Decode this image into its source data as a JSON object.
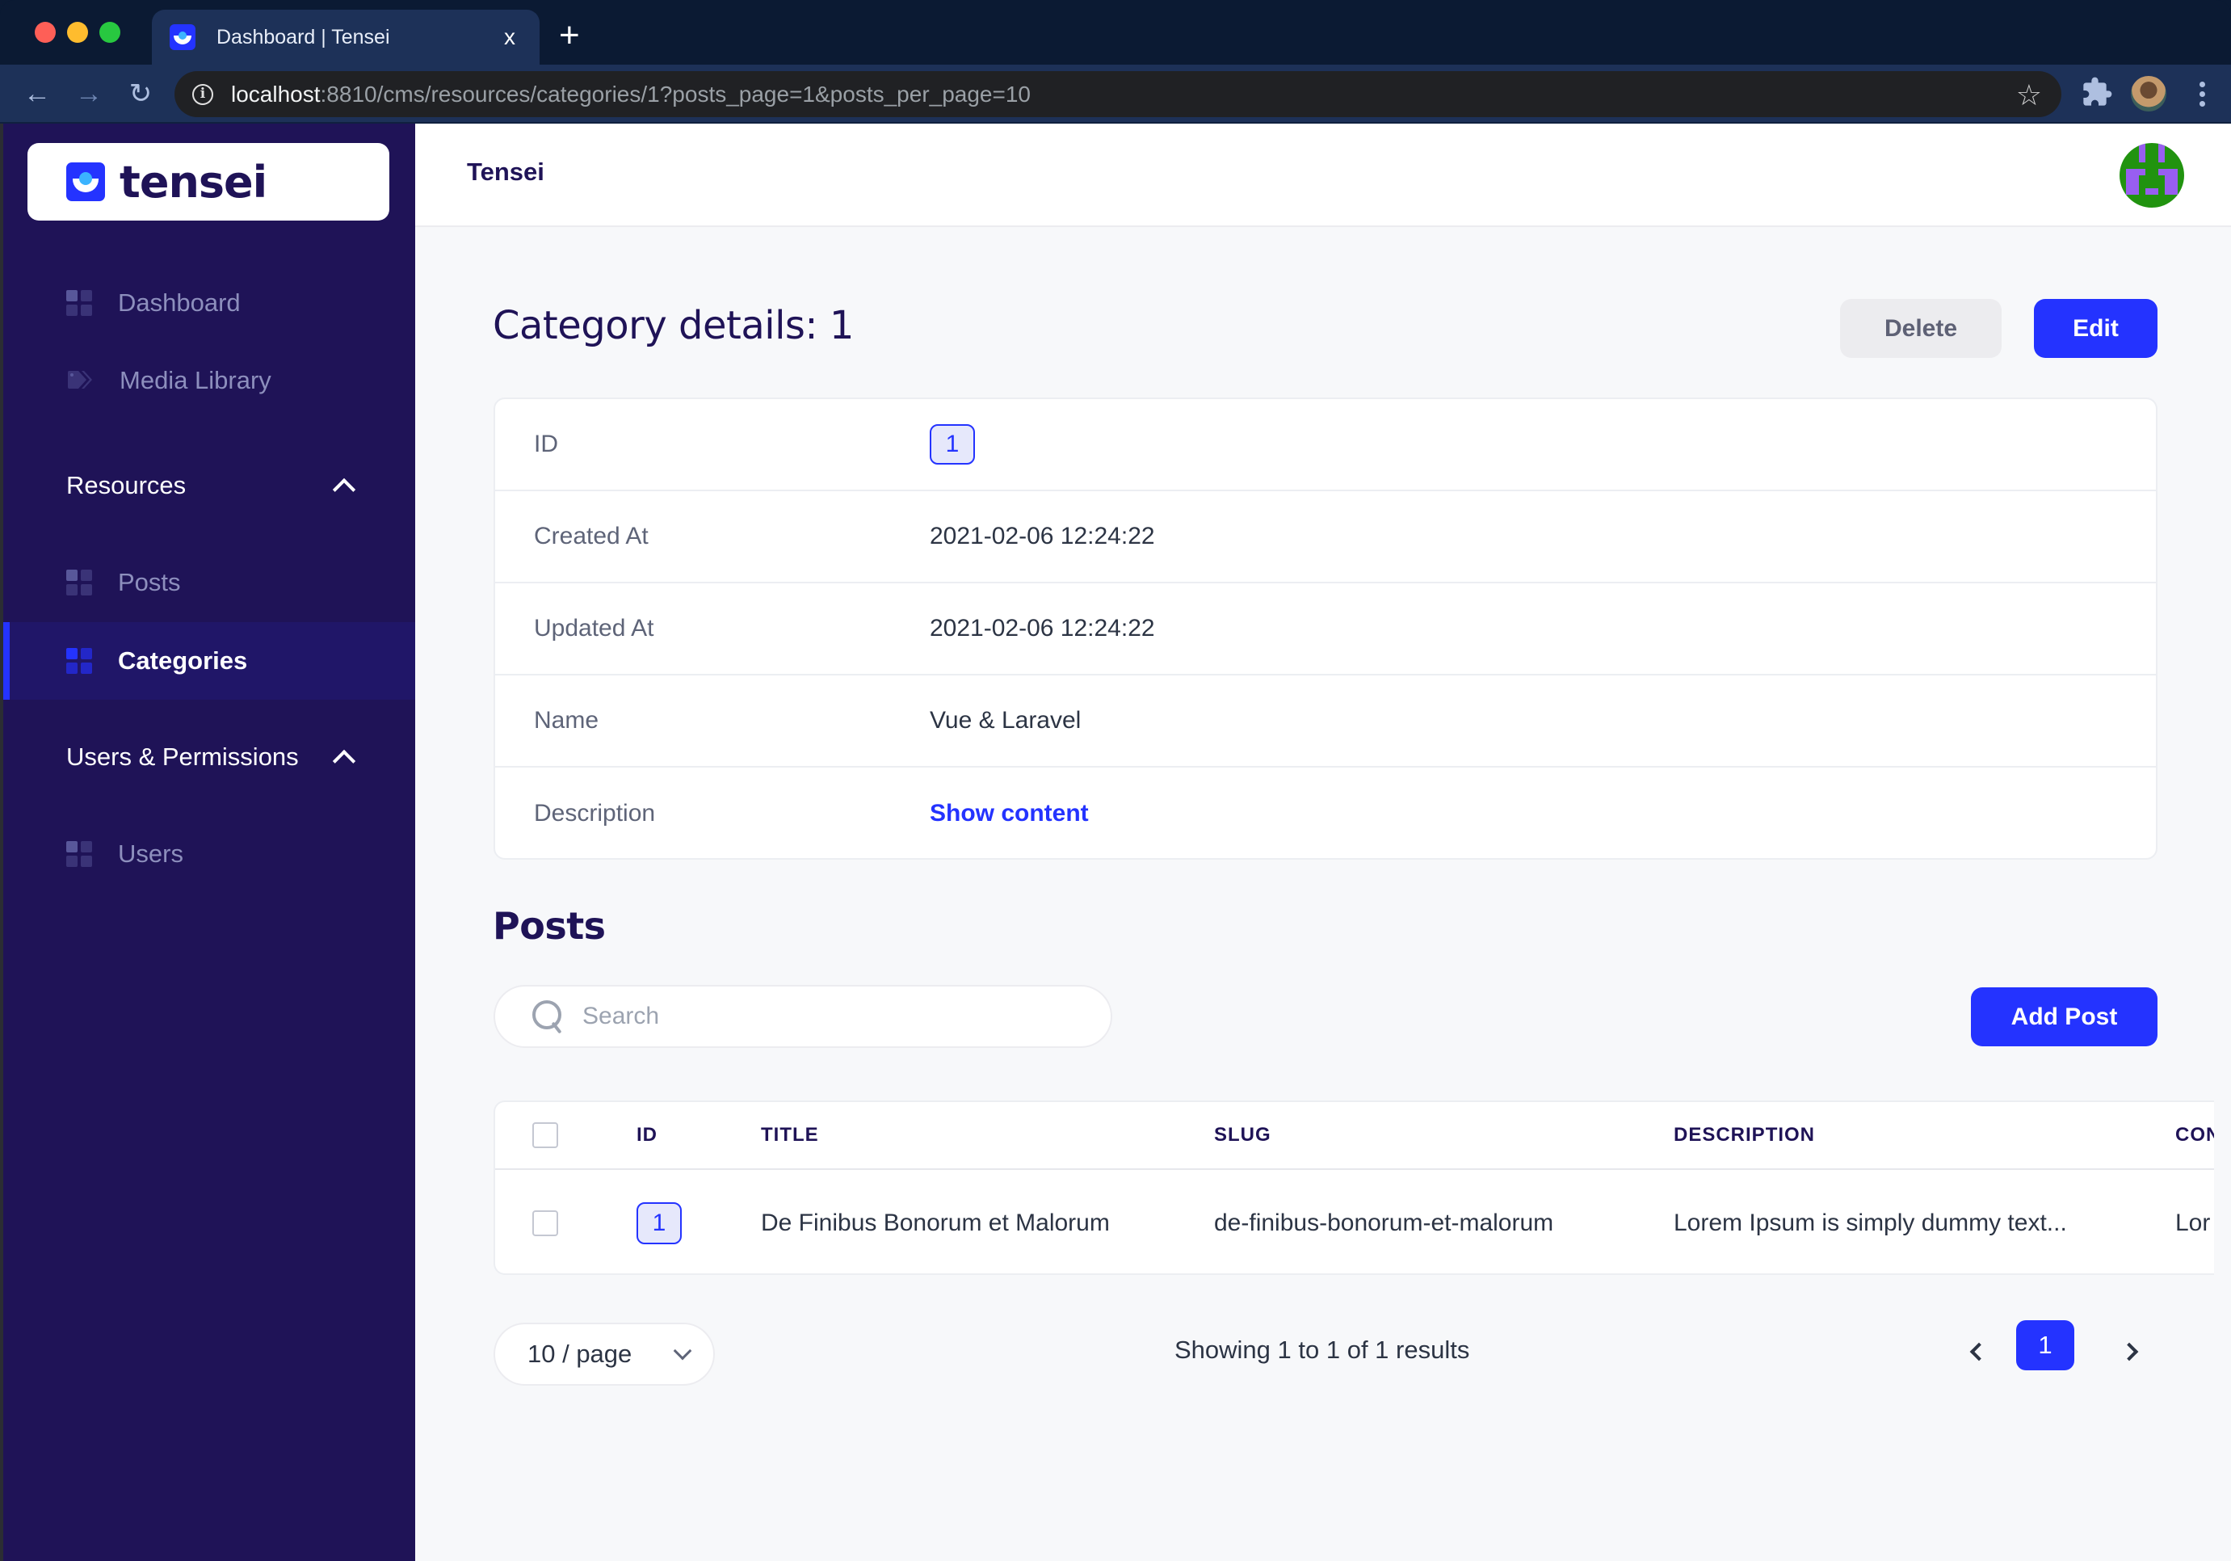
{
  "browser": {
    "tab_title": "Dashboard | Tensei",
    "tab_close": "x",
    "new_tab": "+",
    "url_host": "localhost",
    "url_rest": ":8810/cms/resources/categories/1?posts_page=1&posts_per_page=10",
    "nav": {
      "back": "←",
      "forward": "→",
      "reload": "↻"
    },
    "star": "☆",
    "info": "i"
  },
  "sidebar": {
    "brand": "tensei",
    "items": [
      {
        "label": "Dashboard",
        "icon": "grid-icon"
      },
      {
        "label": "Media Library",
        "icon": "tag-icon"
      }
    ],
    "sections": [
      {
        "label": "Resources",
        "expanded": true,
        "items": [
          {
            "label": "Posts",
            "active": false
          },
          {
            "label": "Categories",
            "active": true
          }
        ]
      },
      {
        "label": "Users & Permissions",
        "expanded": true,
        "items": [
          {
            "label": "Users",
            "active": false
          }
        ]
      }
    ]
  },
  "header": {
    "title": "Tensei"
  },
  "page": {
    "title": "Category details: 1",
    "delete_label": "Delete",
    "edit_label": "Edit"
  },
  "details": [
    {
      "label": "ID",
      "value": "1"
    },
    {
      "label": "Created At",
      "value": "2021-02-06 12:24:22"
    },
    {
      "label": "Updated At",
      "value": "2021-02-06 12:24:22"
    },
    {
      "label": "Name",
      "value": "Vue & Laravel"
    },
    {
      "label": "Description",
      "value": "Show content"
    }
  ],
  "posts": {
    "title": "Posts",
    "search_placeholder": "Search",
    "search_value": "",
    "add_label": "Add Post",
    "columns": [
      "ID",
      "TITLE",
      "SLUG",
      "DESCRIPTION",
      "CON"
    ],
    "rows": [
      {
        "id": "1",
        "title": "De Finibus Bonorum et Malorum",
        "slug": "de-finibus-bonorum-et-malorum",
        "description": "Lorem Ipsum is simply dummy text...",
        "content": "Lor"
      }
    ],
    "per_page": "10 / page",
    "results_text": "Showing 1 to 1 of 1 results",
    "current_page": "1"
  },
  "colors": {
    "accent": "#2433ff",
    "sidebar_bg": "#1f1357",
    "sidebar_active": "#201668",
    "heading": "#1f1357",
    "page_bg": "#f7f8fa"
  }
}
